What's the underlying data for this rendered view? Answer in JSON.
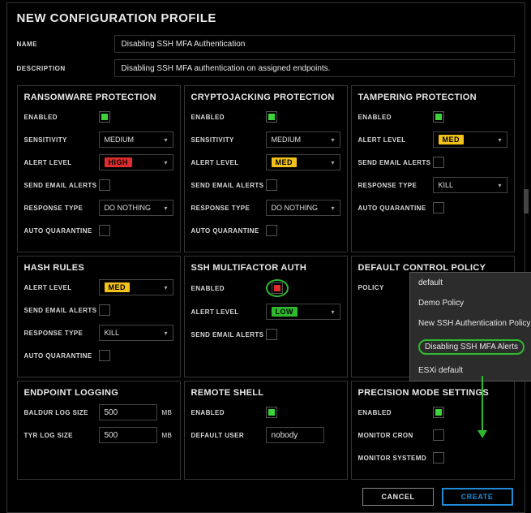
{
  "modal": {
    "title": "NEW CONFIGURATION PROFILE"
  },
  "name": {
    "label": "NAME",
    "value": "Disabling SSH MFA Authentication"
  },
  "description": {
    "label": "DESCRIPTION",
    "value": "Disabling SSH MFA authentication on assigned endpoints."
  },
  "ransomware": {
    "title": "RANSOMWARE PROTECTION",
    "enabled_label": "ENABLED",
    "sensitivity_label": "SENSITIVITY",
    "sensitivity_value": "MEDIUM",
    "alert_label": "ALERT LEVEL",
    "alert_value": "HIGH",
    "email_label": "SEND EMAIL ALERTS",
    "response_label": "RESPONSE TYPE",
    "response_value": "DO NOTHING",
    "quarantine_label": "AUTO QUARANTINE"
  },
  "cryptojacking": {
    "title": "CRYPTOJACKING PROTECTION",
    "enabled_label": "ENABLED",
    "sensitivity_label": "SENSITIVITY",
    "sensitivity_value": "MEDIUM",
    "alert_label": "ALERT LEVEL",
    "alert_value": "MED",
    "email_label": "SEND EMAIL ALERTS",
    "response_label": "RESPONSE TYPE",
    "response_value": "DO NOTHING",
    "quarantine_label": "AUTO QUARANTINE"
  },
  "tampering": {
    "title": "TAMPERING PROTECTION",
    "enabled_label": "ENABLED",
    "alert_label": "ALERT LEVEL",
    "alert_value": "MED",
    "email_label": "SEND EMAIL ALERTS",
    "response_label": "RESPONSE TYPE",
    "response_value": "KILL",
    "quarantine_label": "AUTO QUARANTINE"
  },
  "hash": {
    "title": "HASH RULES",
    "alert_label": "ALERT LEVEL",
    "alert_value": "MED",
    "email_label": "SEND EMAIL ALERTS",
    "response_label": "RESPONSE TYPE",
    "response_value": "KILL",
    "quarantine_label": "AUTO QUARANTINE"
  },
  "sshmfa": {
    "title": "SSH MULTIFACTOR AUTH",
    "enabled_label": "ENABLED",
    "alert_label": "ALERT LEVEL",
    "alert_value": "LOW",
    "email_label": "SEND EMAIL ALERTS"
  },
  "policy": {
    "title": "DEFAULT CONTROL POLICY",
    "label": "POLICY",
    "selected": "default",
    "options": [
      "default",
      "Demo Policy",
      "New SSH Authentication Policy",
      "Disabling SSH MFA Alerts",
      "ESXi default"
    ]
  },
  "logging": {
    "title": "ENDPOINT LOGGING",
    "baldur_label": "BALDUR LOG SIZE",
    "baldur_value": "500",
    "unit": "MB",
    "tyr_label": "TYR LOG SIZE",
    "tyr_value": "500"
  },
  "remote": {
    "title": "REMOTE SHELL",
    "enabled_label": "ENABLED",
    "user_label": "DEFAULT USER",
    "user_value": "nobody"
  },
  "precision": {
    "title": "PRECISION MODE SETTINGS",
    "enabled_label": "ENABLED",
    "cron_label": "MONITOR CRON",
    "systemd_label": "MONITOR SYSTEMD"
  },
  "footer": {
    "cancel": "CANCEL",
    "create": "CREATE"
  }
}
